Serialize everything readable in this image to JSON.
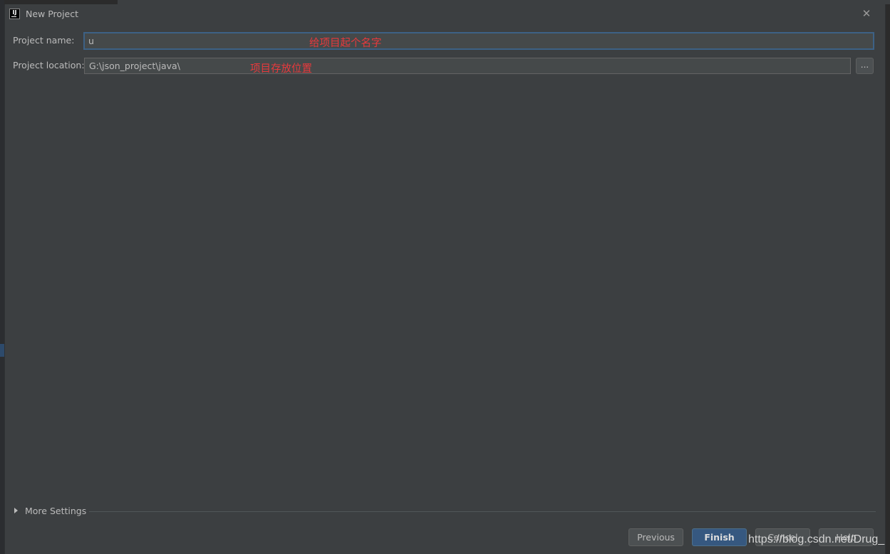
{
  "window": {
    "title": "New Project",
    "icon": "intellij-idea-icon",
    "icon_text": "IJ",
    "close_glyph": "✕"
  },
  "form": {
    "project_name_label": "Project name:",
    "project_name_value": "u",
    "project_name_annotation": "给项目起个名字",
    "project_location_label": "Project location:",
    "project_location_value": "G:\\json_project\\java\\",
    "project_location_annotation": "项目存放位置",
    "browse_label": "..."
  },
  "more_settings": {
    "label": "More Settings"
  },
  "footer": {
    "previous_label": "Previous",
    "finish_label": "Finish",
    "cancel_label": "Cancel",
    "help_label": "Help"
  },
  "watermark": "https://blog.csdn.net/Drug_",
  "colors": {
    "dialog_bg": "#3c3f41",
    "annotation": "#e8393c",
    "focus_border": "#3d6185",
    "default_button": "#365880"
  }
}
